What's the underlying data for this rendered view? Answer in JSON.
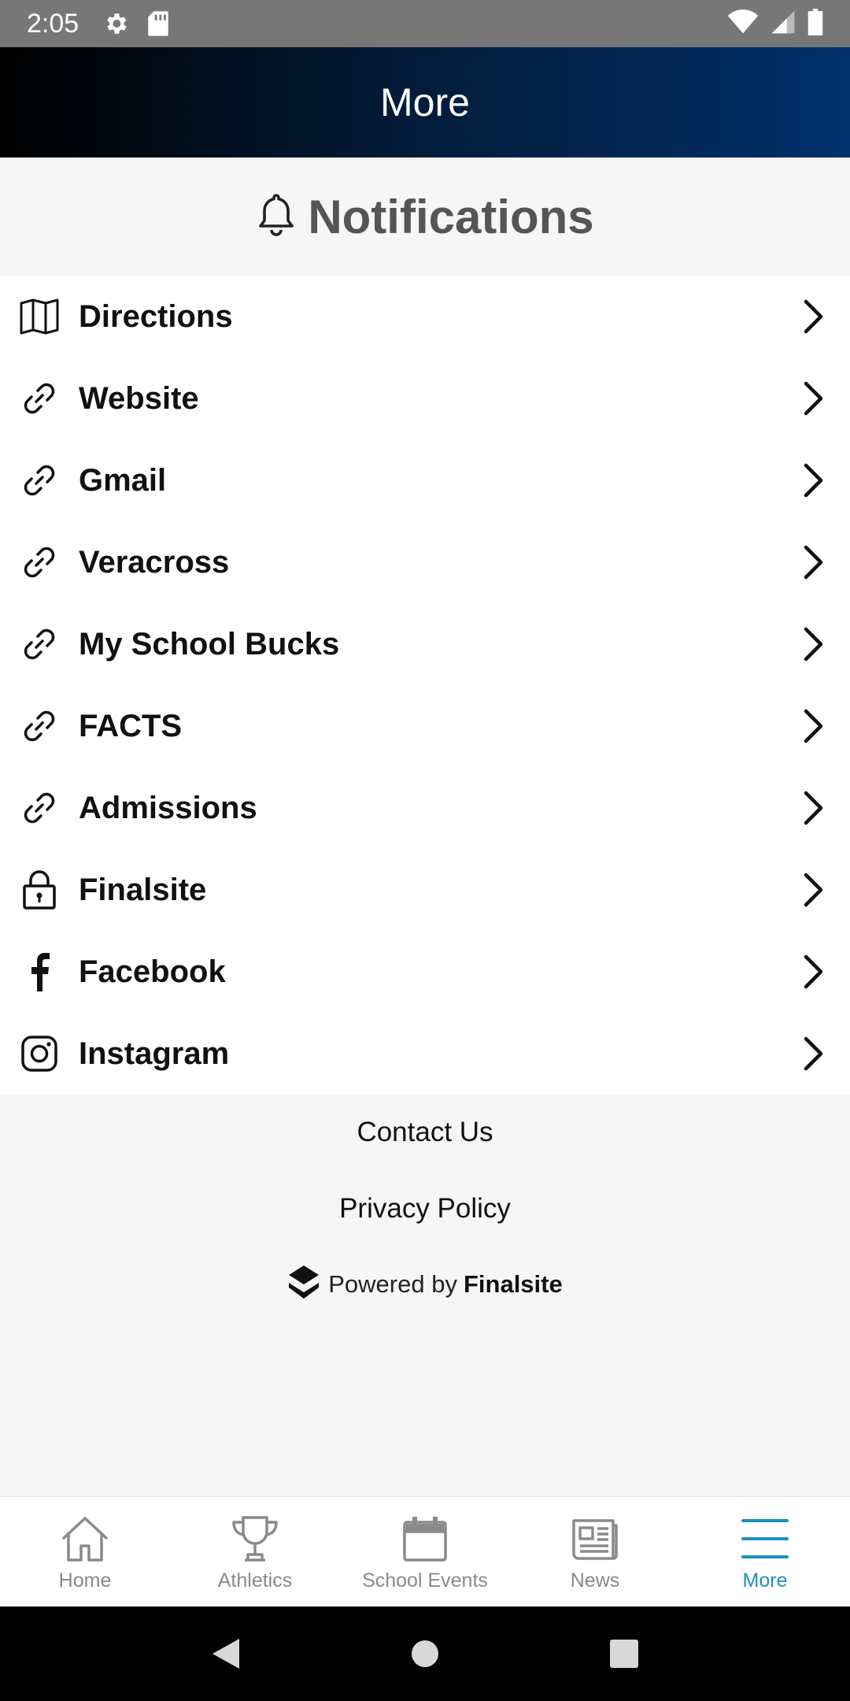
{
  "status_bar": {
    "time": "2:05",
    "icons": [
      "settings-icon",
      "sd-card-icon",
      "wifi-icon",
      "signal-icon",
      "battery-icon"
    ]
  },
  "header": {
    "title": "More"
  },
  "notifications": {
    "label": "Notifications",
    "icon": "bell-icon"
  },
  "menu": {
    "items": [
      {
        "label": "Directions",
        "icon": "map-icon"
      },
      {
        "label": "Website",
        "icon": "link-icon"
      },
      {
        "label": "Gmail",
        "icon": "link-icon"
      },
      {
        "label": "Veracross",
        "icon": "link-icon"
      },
      {
        "label": "My School Bucks",
        "icon": "link-icon"
      },
      {
        "label": "FACTS",
        "icon": "link-icon"
      },
      {
        "label": "Admissions",
        "icon": "link-icon"
      },
      {
        "label": "Finalsite",
        "icon": "lock-icon"
      },
      {
        "label": "Facebook",
        "icon": "facebook-icon"
      },
      {
        "label": "Instagram",
        "icon": "instagram-icon"
      }
    ]
  },
  "footer": {
    "contact": "Contact Us",
    "privacy": "Privacy Policy",
    "powered_prefix": "Powered by",
    "powered_brand": "Finalsite"
  },
  "bottom_nav": {
    "items": [
      {
        "label": "Home",
        "icon": "home-icon"
      },
      {
        "label": "Athletics",
        "icon": "trophy-icon"
      },
      {
        "label": "School Events",
        "icon": "calendar-icon"
      },
      {
        "label": "News",
        "icon": "newspaper-icon"
      },
      {
        "label": "More",
        "icon": "menu-icon",
        "active": true
      }
    ]
  },
  "colors": {
    "header_start": "#000000",
    "header_end": "#01306b",
    "active_nav": "#1c8fc2",
    "inactive_nav": "#8a8a8a"
  }
}
